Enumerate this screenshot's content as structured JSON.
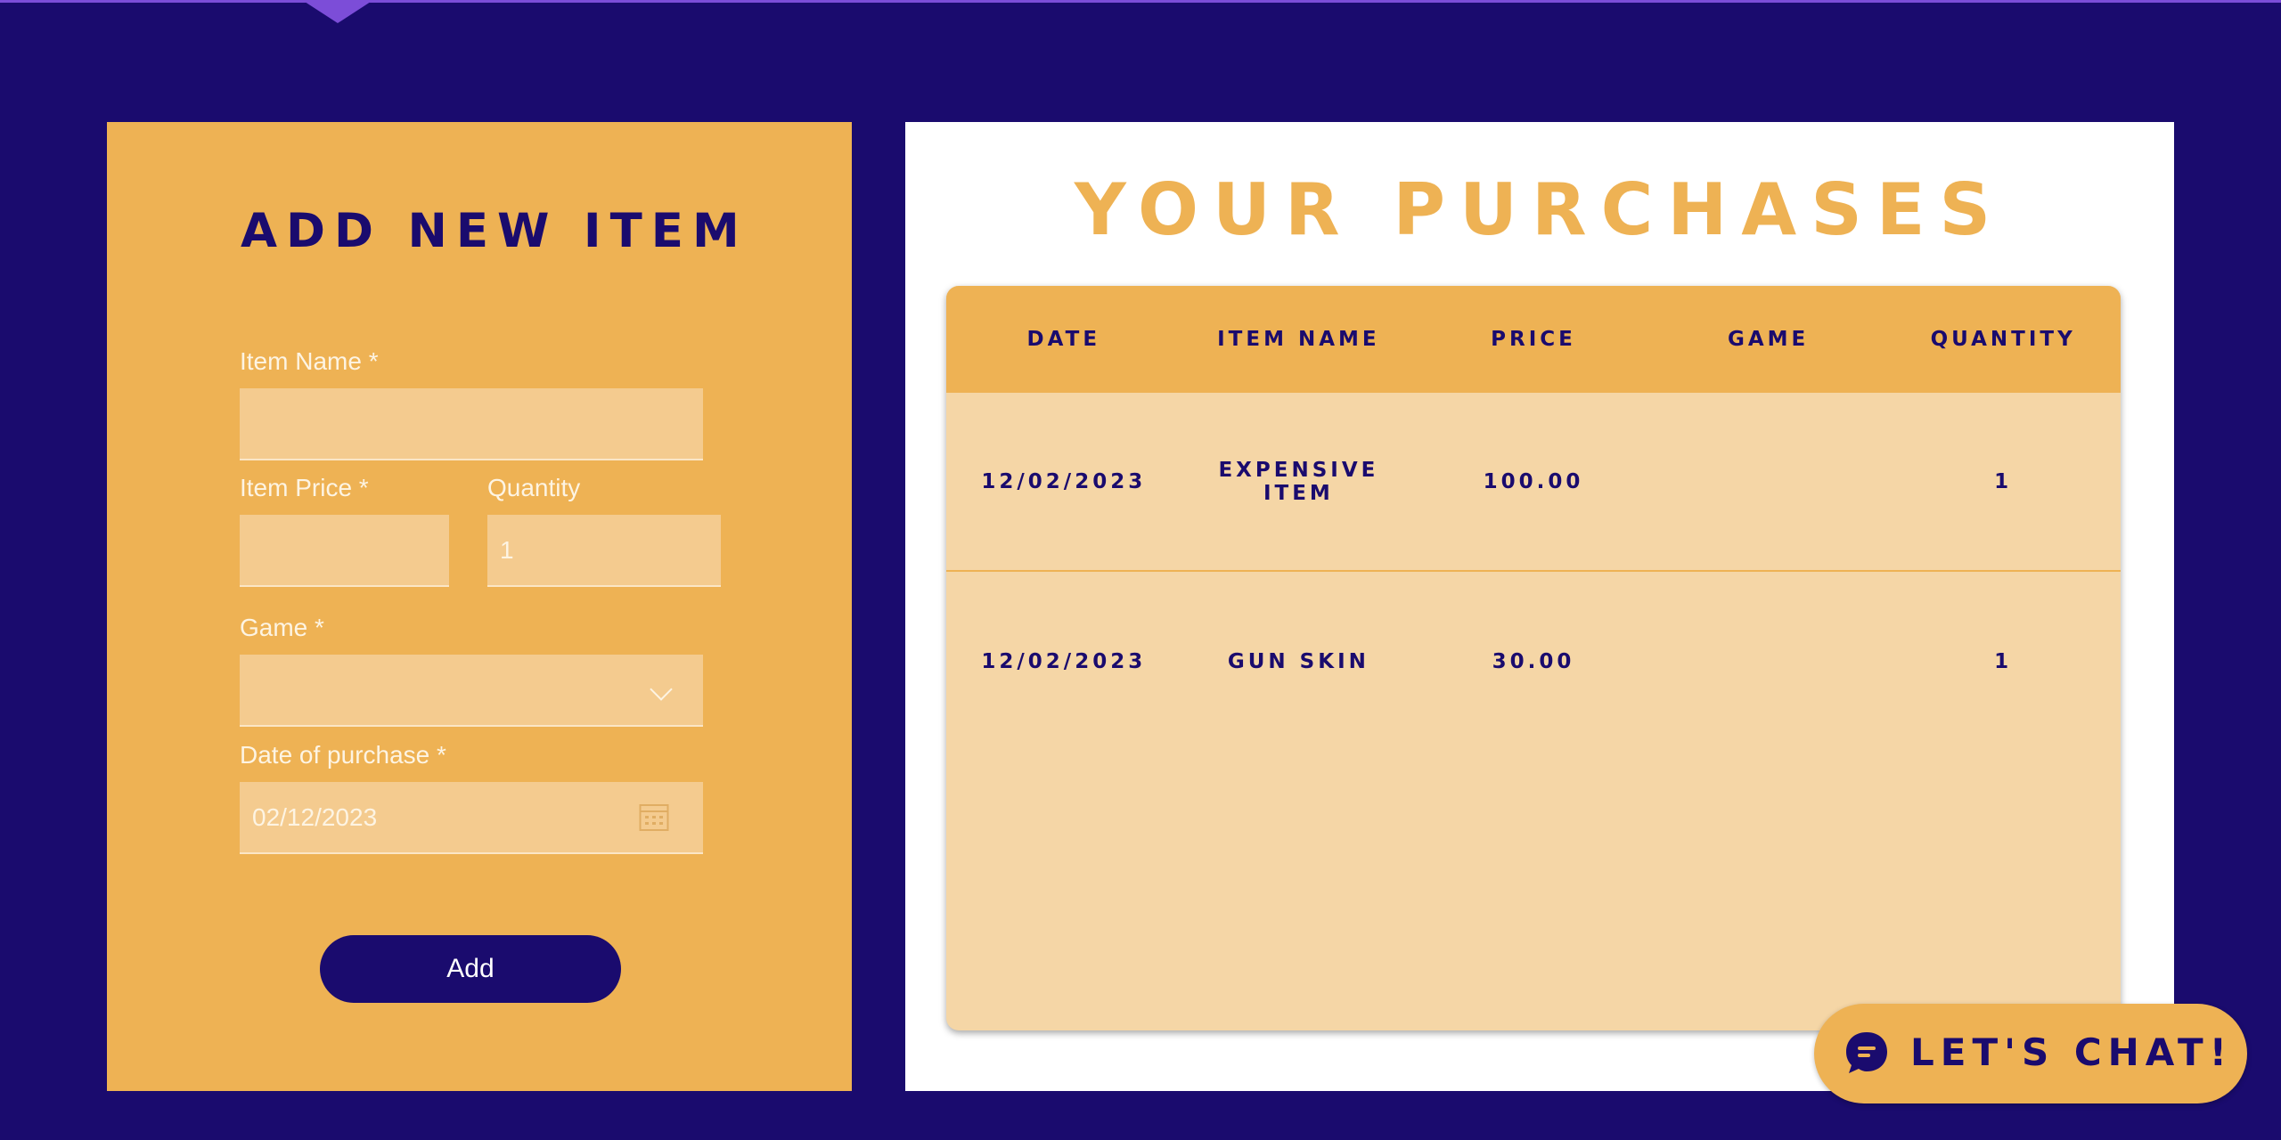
{
  "colors": {
    "background": "#1a0b6e",
    "accent": "#eeb254",
    "field": "#f4cb8f",
    "table_body": "#f5d6a6",
    "navy": "#1a0b6e"
  },
  "add_form": {
    "title": "ADD NEW ITEM",
    "item_name_label": "Item Name *",
    "item_name_value": "",
    "item_price_label": "Item Price *",
    "item_price_value": "",
    "quantity_label": "Quantity",
    "quantity_placeholder": "1",
    "game_label": "Game *",
    "game_value": "",
    "date_label": "Date of purchase *",
    "date_value": "02/12/2023",
    "add_button": "Add",
    "icons": {
      "dropdown": "chevron-down-icon",
      "date": "calendar-icon"
    }
  },
  "purchases": {
    "title": "YOUR PURCHASES",
    "columns": [
      "DATE",
      "ITEM NAME",
      "PRICE",
      "GAME",
      "QUANTITY"
    ],
    "rows": [
      {
        "date": "12/02/2023",
        "item_name": "EXPENSIVE ITEM",
        "price": "100.00",
        "game": "",
        "quantity": "1"
      },
      {
        "date": "12/02/2023",
        "item_name": "GUN SKIN",
        "price": "30.00",
        "game": "",
        "quantity": "1"
      }
    ]
  },
  "chat": {
    "label": "LET'S CHAT!",
    "icon": "chat-bubble-icon"
  }
}
